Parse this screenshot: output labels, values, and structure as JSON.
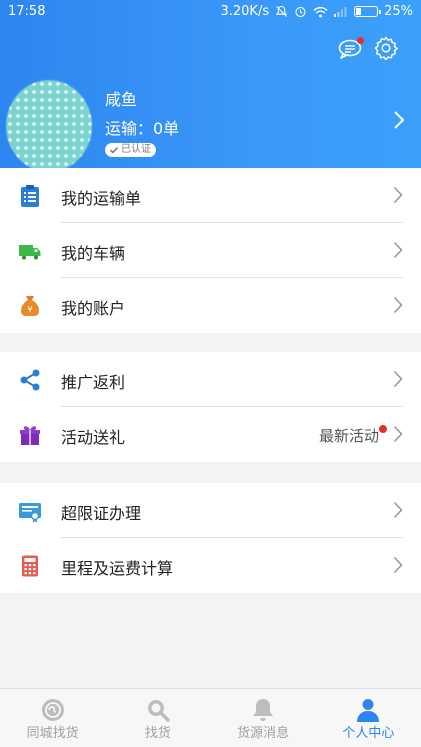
{
  "status_bar": {
    "time": "17:58",
    "net_speed": "3.20K/s",
    "battery": "25%"
  },
  "colors": {
    "header_blue": "#2d86f0",
    "active_tab": "#2d86f0",
    "badge_red": "#e53030"
  },
  "profile": {
    "name": "咸鱼",
    "transport_summary": "运输：0单",
    "verified_label": "已认证"
  },
  "menu_groups": [
    [
      {
        "label": "我的运输单",
        "icon": "document-list-icon"
      },
      {
        "label": "我的车辆",
        "icon": "truck-icon"
      },
      {
        "label": "我的账户",
        "icon": "money-bag-icon"
      }
    ],
    [
      {
        "label": "推广返利",
        "icon": "share-icon"
      },
      {
        "label": "活动送礼",
        "icon": "gift-icon",
        "extra": "最新活动"
      }
    ],
    [
      {
        "label": "超限证办理",
        "icon": "certificate-icon"
      },
      {
        "label": "里程及运费计算",
        "icon": "calculator-icon"
      }
    ]
  ],
  "tabs": [
    {
      "label": "同城找货",
      "icon": "city-cargo-icon",
      "active": false
    },
    {
      "label": "找货",
      "icon": "search-icon",
      "active": false
    },
    {
      "label": "货源消息",
      "icon": "bell-icon",
      "active": false
    },
    {
      "label": "个人中心",
      "icon": "user-icon",
      "active": true
    }
  ]
}
